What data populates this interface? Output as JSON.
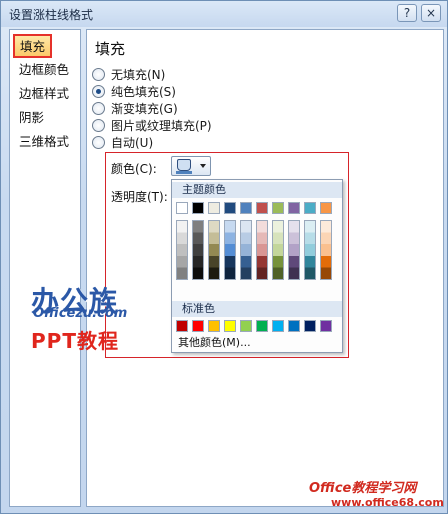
{
  "window": {
    "title": "设置涨柱线格式",
    "help_glyph": "?",
    "close_glyph": "×"
  },
  "nav": {
    "items": [
      {
        "label": "填充",
        "selected": true
      },
      {
        "label": "边框颜色",
        "selected": false
      },
      {
        "label": "边框样式",
        "selected": false
      },
      {
        "label": "阴影",
        "selected": false
      },
      {
        "label": "三维格式",
        "selected": false
      }
    ]
  },
  "fill": {
    "heading": "填充",
    "options": [
      {
        "label": "无填充(N)",
        "checked": false
      },
      {
        "label": "纯色填充(S)",
        "checked": true
      },
      {
        "label": "渐变填充(G)",
        "checked": false
      },
      {
        "label": "图片或纹理填充(P)",
        "checked": false
      },
      {
        "label": "自动(U)",
        "checked": false
      }
    ],
    "color_label": "颜色(C):",
    "transparency_label": "透明度(T):",
    "current_fill_color": "#4f81bd"
  },
  "palette": {
    "theme_header": "主题颜色",
    "theme_colors": [
      "#ffffff",
      "#000000",
      "#eeece1",
      "#1f497d",
      "#4f81bd",
      "#c0504d",
      "#9bbb59",
      "#8064a2",
      "#4bacc6",
      "#f79646"
    ],
    "theme_shades": [
      [
        "#f2f2f2",
        "#d9d9d9",
        "#bfbfbf",
        "#a6a6a6",
        "#808080"
      ],
      [
        "#7f7f7f",
        "#595959",
        "#3f3f3f",
        "#262626",
        "#0d0d0d"
      ],
      [
        "#ddd9c3",
        "#c4bd97",
        "#938953",
        "#494429",
        "#1d1b10"
      ],
      [
        "#c6d9f0",
        "#8db3e2",
        "#548dd4",
        "#17365d",
        "#0f243e"
      ],
      [
        "#dbe5f1",
        "#b8cce4",
        "#95b3d7",
        "#366092",
        "#244061"
      ],
      [
        "#f2dcdb",
        "#e5b9b7",
        "#d99694",
        "#953734",
        "#632423"
      ],
      [
        "#ebf1dd",
        "#d7e3bc",
        "#c3d69b",
        "#76923c",
        "#4f6128"
      ],
      [
        "#e5e0ec",
        "#ccc1d9",
        "#b2a2c7",
        "#5f497a",
        "#3f3151"
      ],
      [
        "#dbeef3",
        "#b7dde8",
        "#92cddc",
        "#31859b",
        "#205867"
      ],
      [
        "#fdeada",
        "#fbd5b5",
        "#fac08f",
        "#e36c09",
        "#974806"
      ]
    ],
    "standard_header": "标准色",
    "standard_colors": [
      "#c00000",
      "#ff0000",
      "#ffc000",
      "#ffff00",
      "#92d050",
      "#00b050",
      "#00b0f0",
      "#0070c0",
      "#002060",
      "#7030a0"
    ],
    "more_colors": "其他颜色(M)..."
  },
  "watermarks": {
    "logo_cn": "办公族",
    "logo_domain": "Officezu.com",
    "ppt": "PPT教程",
    "site_name": "Office教程学习网",
    "site_url": "www.office68.com"
  }
}
